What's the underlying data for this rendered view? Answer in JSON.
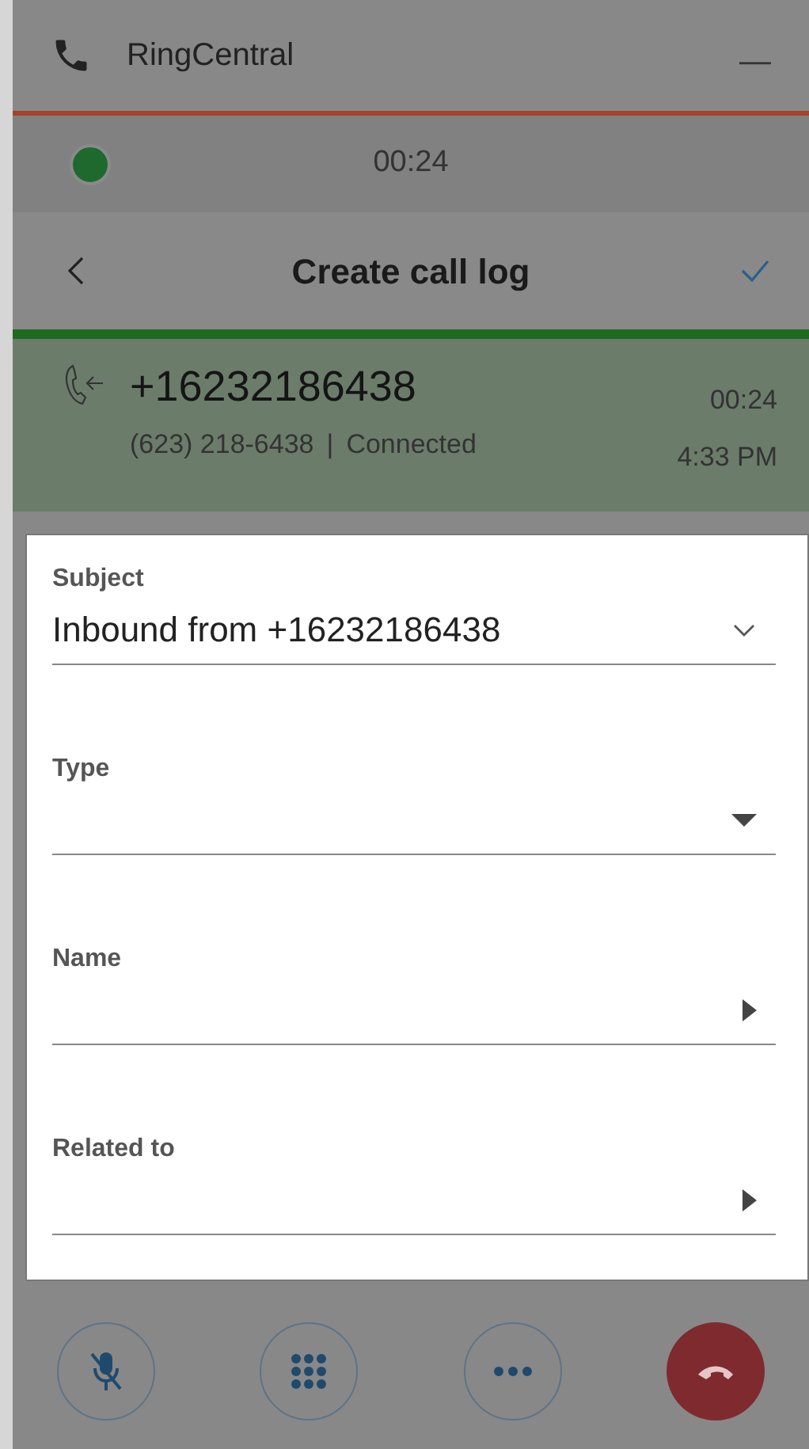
{
  "window": {
    "title": "RingCentral",
    "minimize": "—"
  },
  "call_status": {
    "timer": "00:24"
  },
  "nav": {
    "title": "Create call log"
  },
  "call": {
    "number": "+16232186438",
    "formatted": "(623) 218-6438",
    "separator": "|",
    "status": "Connected",
    "duration": "00:24",
    "time": "4:33 PM"
  },
  "form": {
    "fields": [
      {
        "label": "Subject",
        "value": "Inbound from +16232186438",
        "kind": "select"
      },
      {
        "label": "Type",
        "kind": "dropdown"
      },
      {
        "label": "Name",
        "kind": "picker"
      },
      {
        "label": "Related to",
        "kind": "picker"
      }
    ]
  },
  "controls": [
    {
      "kind": "mute"
    },
    {
      "kind": "keypad"
    },
    {
      "kind": "more"
    },
    {
      "kind": "hangup"
    }
  ]
}
